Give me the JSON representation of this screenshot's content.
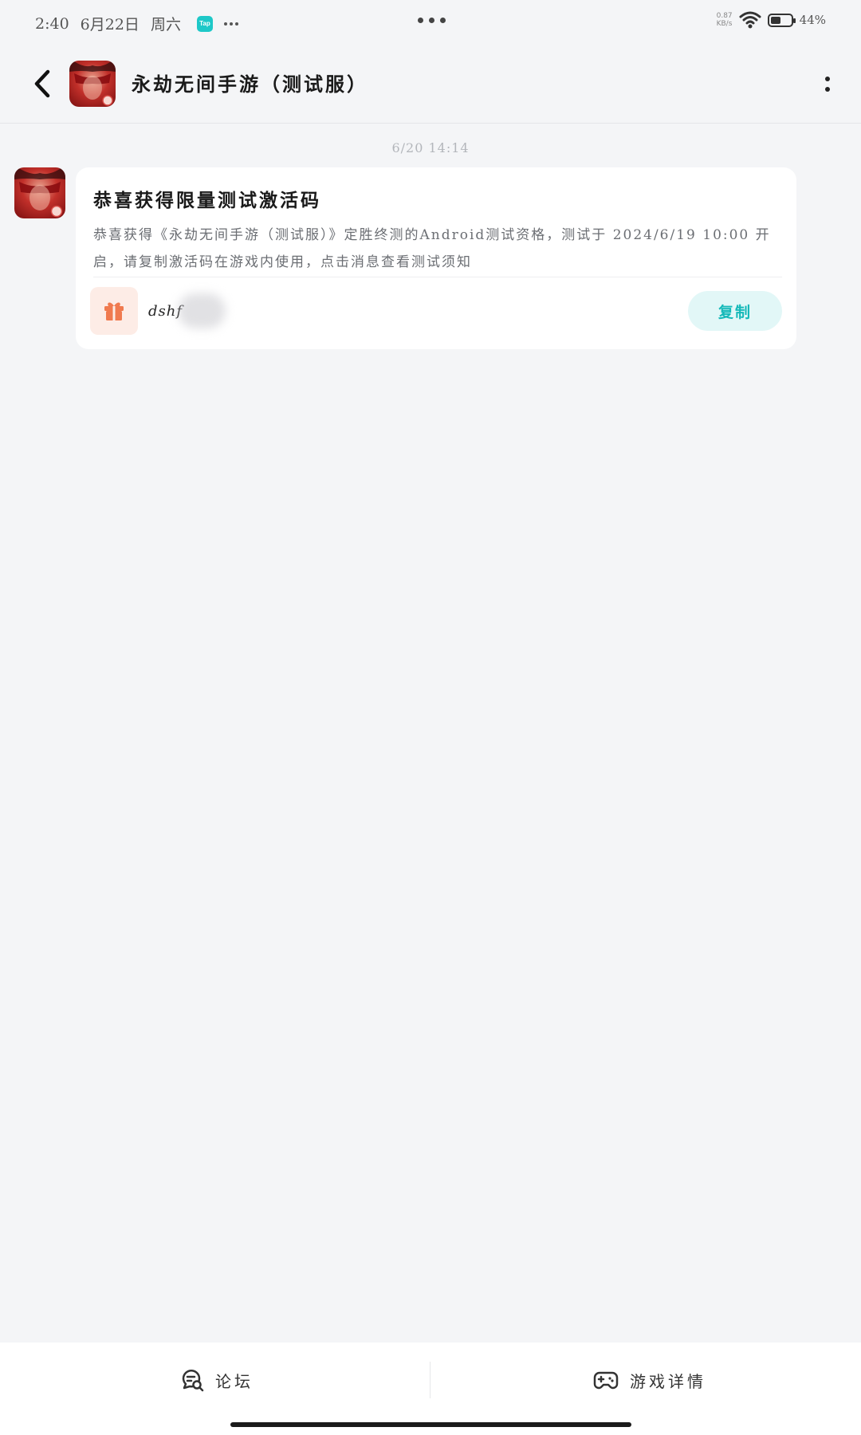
{
  "status_bar": {
    "time": "2:40",
    "date": "6月22日",
    "weekday": "周六",
    "notification_app": "Tap",
    "network_speed_value": "0.87",
    "network_speed_unit": "KB/s",
    "battery_percent": "44",
    "battery_percent_label": "44%"
  },
  "header": {
    "title": "永劫无间手游（测试服）",
    "avatar_icon": "game-icon"
  },
  "timestamp": "6/20  14:14",
  "message": {
    "title": "恭喜获得限量测试激活码",
    "body": "恭喜获得《永劫无间手游（测试服）》定胜终测的Android测试资格，测试于 2024/6/19 10:00 开启，请复制激活码在游戏内使用，点击消息查看测试须知",
    "code_visible": "dshf",
    "copy_label": "复制",
    "gift_icon": "gift-icon",
    "accent_color": "#15b9b9",
    "gift_color": "#f07a4f"
  },
  "bottom_nav": {
    "forum_label": "论坛",
    "game_details_label": "游戏详情"
  }
}
